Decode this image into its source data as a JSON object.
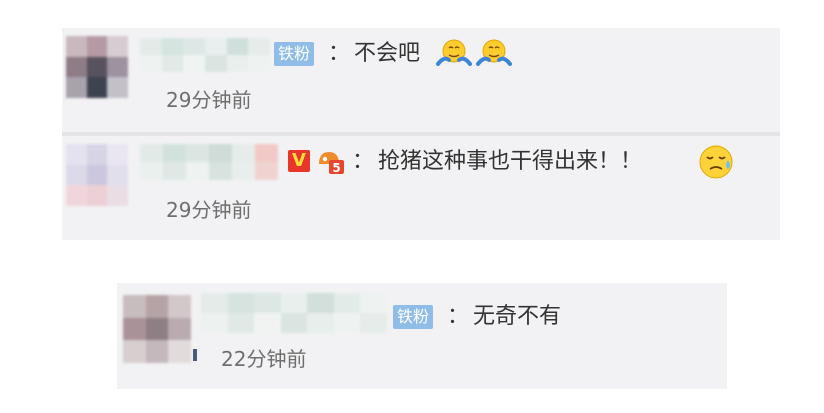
{
  "comments": [
    {
      "badge": "铁粉",
      "colon": "：",
      "text": "不会吧",
      "emojis": [
        "shrug-emoji",
        "shrug-emoji"
      ],
      "time": "29分钟前"
    },
    {
      "badges": [
        "v-badge",
        "level-badge"
      ],
      "colon": "：",
      "text": "抢猪这种事也干得出来！！",
      "emojis": [
        "sweat-emoji"
      ],
      "time": "29分钟前"
    },
    {
      "badge": "铁粉",
      "colon": "：",
      "text": "无奇不有",
      "time": "22分钟前"
    }
  ],
  "badges": {
    "v_label": "V",
    "level_label": "5"
  },
  "colors": {
    "card_bg": "#f2f2f4",
    "fan_badge": "#8fbde7",
    "text": "#333333",
    "timestamp": "#6e6e6e"
  }
}
